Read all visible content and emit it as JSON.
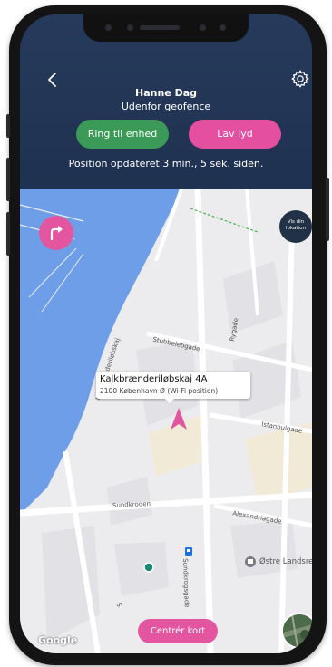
{
  "header": {
    "name": "Hanne Dag",
    "status": "Udenfor geofence",
    "ring_label": "Ring til enhed",
    "sound_label": "Lav lyd",
    "updated_text": "Position opdateret 3 min., 5 sek. siden."
  },
  "map": {
    "vis_label": "Vis din lokation",
    "callout_address": "Kalkbrænderiløbskaj 4A",
    "callout_sub": "2100 København Ø (Wi-Fi position)",
    "streets": {
      "stubbeleb": "Stubbelebgade",
      "kalkbr": "Kalkbrænderiløbskaj",
      "istanbul": "Istanbulgade",
      "sundkrogen": "Sundkrogen",
      "alexandria": "Alexandriagade",
      "sundkrogsgade": "Sundkrogsgade",
      "rygade": "Rygade",
      "partial_s": "S"
    },
    "poi": "Østre Landsret",
    "center_label": "Centrér kort",
    "google": "Google"
  },
  "colors": {
    "header": "#233656",
    "green": "#3c9a58",
    "pink": "#e44f9f",
    "water": "#6f9ee8",
    "map_land": "#ececef"
  },
  "icons": [
    "back-icon",
    "gear-icon",
    "direction-icon",
    "location-pin-icon",
    "metro-icon",
    "poi-icon",
    "layers-icon"
  ]
}
